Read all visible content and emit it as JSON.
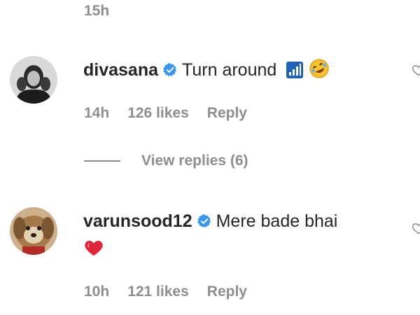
{
  "top_timestamp": "15h",
  "comments": [
    {
      "username": "divasana",
      "text": "Turn around",
      "time": "14h",
      "likes": "126 likes",
      "reply_label": "Reply"
    },
    {
      "username": "varunsood12",
      "text": "Mere bade bhai",
      "time": "10h",
      "likes": "121 likes",
      "reply_label": "Reply"
    }
  ],
  "view_replies": "View replies (6)",
  "colors": {
    "verified": "#3897f0",
    "muted": "#8e8e8e",
    "heart": "#e0243a"
  }
}
